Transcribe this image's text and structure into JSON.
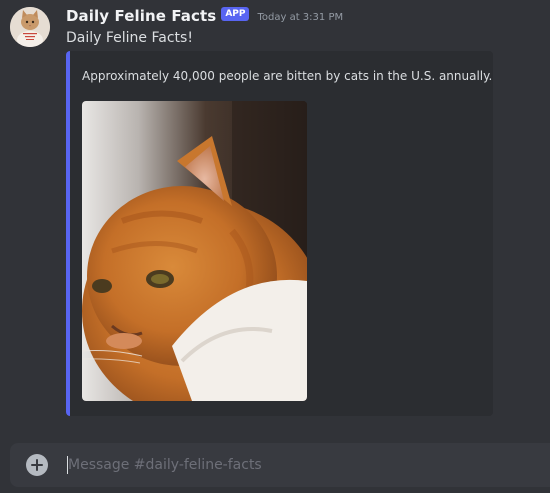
{
  "message": {
    "author": "Daily Feline Facts",
    "badge": "APP",
    "timestamp": "Today at 3:31 PM",
    "text": "Daily Feline Facts!",
    "avatar": "cat-avatar-icon",
    "embed": {
      "accent_color": "#5865f2",
      "description": "Approximately 40,000 people are bitten by cats in the U.S. annually.",
      "image": "orange-white-cat-photo"
    }
  },
  "composer": {
    "placeholder": "Message #daily-feline-facts",
    "add_icon": "plus-circle-icon"
  },
  "colors": {
    "background": "#313338",
    "embed_background": "#2b2d31",
    "composer_background": "#383a40",
    "brand": "#5865f2"
  }
}
